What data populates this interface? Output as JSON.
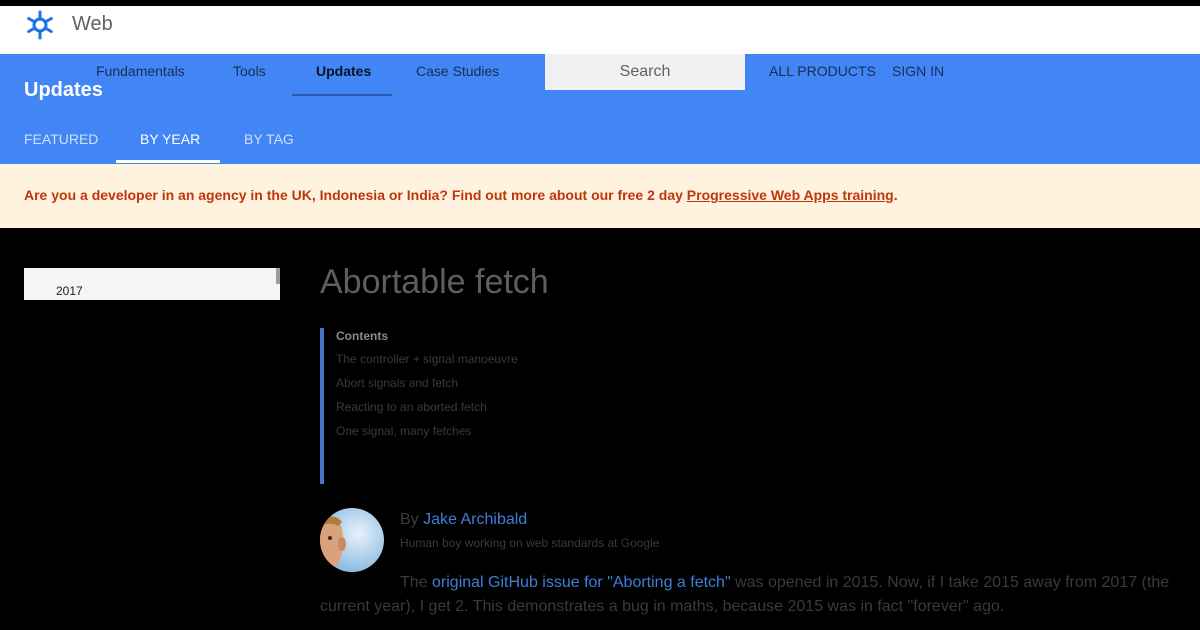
{
  "header": {
    "site_name": "Web"
  },
  "nav": {
    "links": [
      "Fundamentals",
      "Tools",
      "Updates",
      "Case Studies"
    ],
    "active": "Updates",
    "search_placeholder": "Search",
    "all_products": "ALL PRODUCTS",
    "sign_in": "SIGN IN"
  },
  "section": {
    "title": "Updates",
    "tabs": [
      "FEATURED",
      "BY YEAR",
      "BY TAG"
    ],
    "active_tab": "BY YEAR"
  },
  "banner": {
    "text": "Are you a developer in an agency in the UK, Indonesia or India? Find out more about our free 2 day ",
    "link": "Progressive Web Apps training",
    "suffix": "."
  },
  "sidebar": {
    "year": "2017"
  },
  "article": {
    "title": "Abortable fetch",
    "toc_heading": "Contents",
    "toc": [
      "The controller + signal manoeuvre",
      "Abort signals and fetch",
      "Reacting to an aborted fetch",
      "One signal, many fetches"
    ],
    "author_prefix": "By ",
    "author_name": "Jake Archibald",
    "author_bio": "Human boy working on web standards at Google",
    "para_before": "The ",
    "para_link": "original GitHub issue for \"Aborting a fetch\"",
    "para_after": " was opened in 2015. Now, if I take 2015 away from 2017 (the current year), I get 2. This demonstrates a bug in maths, because 2015 was in fact \"forever\" ago."
  },
  "colors": {
    "brand_blue": "#4285f4",
    "banner_bg": "#fff3e0",
    "banner_text": "#bf360c",
    "link": "#3d7fd8"
  }
}
